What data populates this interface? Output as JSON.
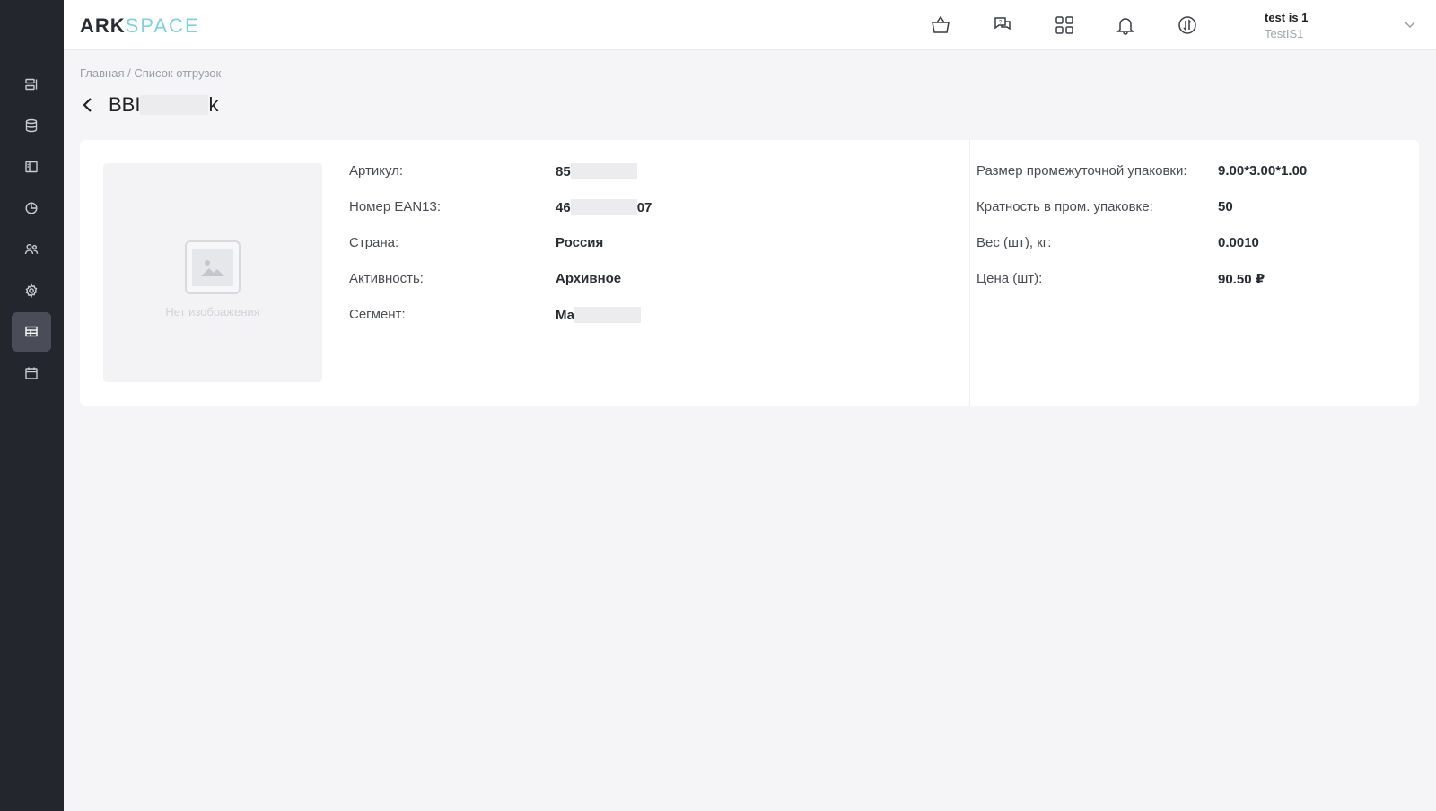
{
  "brand": {
    "part1": "ARK",
    "part2": "SPACE"
  },
  "header": {
    "user": {
      "name": "test is 1",
      "company": "TestIS1"
    }
  },
  "breadcrumb": {
    "home": "Главная",
    "separator": "/",
    "current": "Список отгрузок"
  },
  "page": {
    "title_start": "BBI",
    "title_end": "k"
  },
  "image_placeholder": {
    "caption": "Нет изображения"
  },
  "details_left": [
    {
      "label": "Артикул:",
      "value_start": "85",
      "value_end": ""
    },
    {
      "label": "Номер EAN13:",
      "value_start": "46",
      "value_end": "07"
    },
    {
      "label": "Страна:",
      "value_start": "Россия",
      "value_end": ""
    },
    {
      "label": "Активность:",
      "value_start": "Архивное",
      "value_end": ""
    },
    {
      "label": "Сегмент:",
      "value_start": "Ма",
      "value_end": ""
    }
  ],
  "details_right": [
    {
      "label": "Размер промежуточной упаковки:",
      "value": "9.00*3.00*1.00"
    },
    {
      "label": "Кратность в пром. упаковке:",
      "value": "50"
    },
    {
      "label": "Вес (шт), кг:",
      "value": "0.0010"
    },
    {
      "label": "Цена (шт):",
      "value": "90.50 ₽"
    }
  ],
  "colors": {
    "sidebar": "#24262e",
    "sidebar_active": "#4a4d57",
    "accent": "#7fd1de",
    "background": "#f5f5f8"
  },
  "icons": {
    "sidebar": [
      "list-icon",
      "database-icon",
      "book-icon",
      "chart-pie-icon",
      "users-icon",
      "settings-icon",
      "table-icon",
      "calendar-icon"
    ],
    "header": [
      "basket-icon",
      "support-chat-icon",
      "apps-grid-icon",
      "bell-icon",
      "exchange-icon"
    ]
  }
}
